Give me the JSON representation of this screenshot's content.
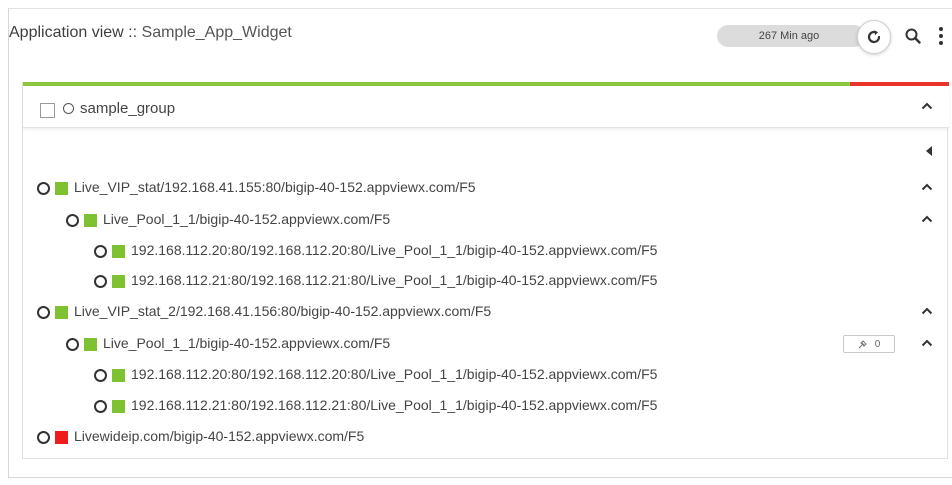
{
  "header": {
    "title_lead": "Application view",
    "title_sep": " :: ",
    "app_name": "Sample_App_Widget",
    "last_updated": "267 Min ago"
  },
  "status_bar": {
    "healthy_fraction": 0.893,
    "color_ok": "#8dc63f",
    "color_bad": "#e8342b"
  },
  "group": {
    "name": "sample_group"
  },
  "tree": [
    {
      "level": 0,
      "status": "green",
      "label": "Live_VIP_stat/192.168.41.155:80/bigip-40-152.appviewx.com/F5",
      "expandable": true
    },
    {
      "level": 1,
      "status": "green",
      "label": "Live_Pool_1_1/bigip-40-152.appviewx.com/F5",
      "expandable": true
    },
    {
      "level": 2,
      "status": "green",
      "label": "192.168.112.20:80/192.168.112.20:80/Live_Pool_1_1/bigip-40-152.appviewx.com/F5",
      "expandable": false
    },
    {
      "level": 2,
      "status": "green",
      "label": "192.168.112.21:80/192.168.112.21:80/Live_Pool_1_1/bigip-40-152.appviewx.com/F5",
      "expandable": false
    },
    {
      "level": 0,
      "status": "green",
      "label": "Live_VIP_stat_2/192.168.41.156:80/bigip-40-152.appviewx.com/F5",
      "expandable": true
    },
    {
      "level": 1,
      "status": "green",
      "label": "Live_Pool_1_1/bigip-40-152.appviewx.com/F5",
      "expandable": true,
      "pin_count": "0"
    },
    {
      "level": 2,
      "status": "green",
      "label": "192.168.112.20:80/192.168.112.20:80/Live_Pool_1_1/bigip-40-152.appviewx.com/F5",
      "expandable": false
    },
    {
      "level": 2,
      "status": "green",
      "label": "192.168.112.21:80/192.168.112.21:80/Live_Pool_1_1/bigip-40-152.appviewx.com/F5",
      "expandable": false
    },
    {
      "level": 0,
      "status": "red",
      "label": "Livewideip.com/bigip-40-152.appviewx.com/F5",
      "expandable": false
    }
  ],
  "colors": {
    "green": "#7ec232",
    "red": "#ee1c1c"
  },
  "icons": {
    "refresh": "refresh-icon",
    "search": "search-icon",
    "more": "more-vertical-icon",
    "chevron": "chevron-up-icon",
    "collapse": "caret-left-icon",
    "pin": "pin-icon"
  }
}
